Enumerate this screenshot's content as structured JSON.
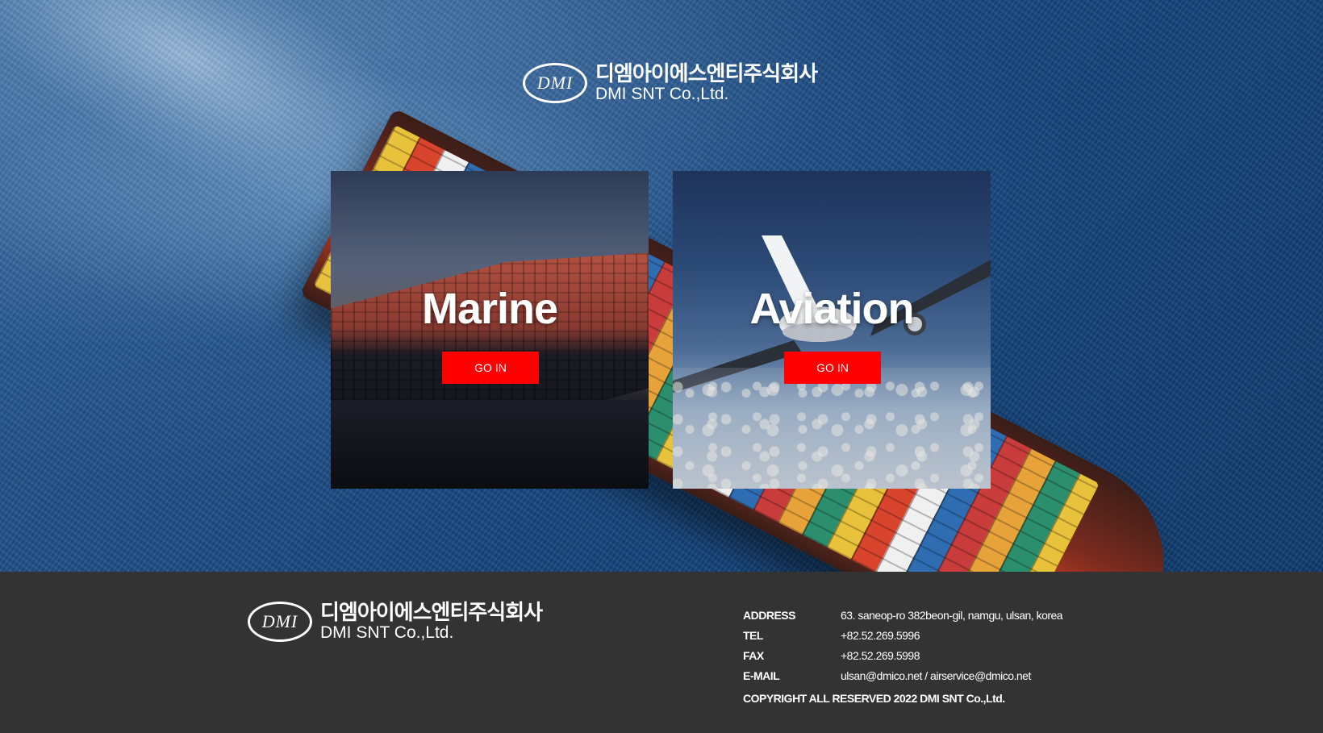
{
  "header": {
    "logo_mark": "DMI",
    "company_korean": "디엠아이에스엔티주식회사",
    "company_english": "DMI SNT Co.,Ltd."
  },
  "cards": [
    {
      "title": "Marine",
      "button_label": "GO IN"
    },
    {
      "title": "Aviation",
      "button_label": "GO IN"
    }
  ],
  "footer": {
    "logo_mark": "DMI",
    "company_korean": "디엠아이에스엔티주식회사",
    "company_english": "DMI SNT Co.,Ltd.",
    "info": [
      {
        "label": "ADDRESS",
        "value": "63. saneop-ro 382beon-gil, namgu, ulsan, korea"
      },
      {
        "label": "TEL",
        "value": "+82.52.269.5996"
      },
      {
        "label": "FAX",
        "value": "+82.52.269.5998"
      },
      {
        "label": "E-MAIL",
        "value": "ulsan@dmico.net / airservice@dmico.net"
      }
    ],
    "copyright": "COPYRIGHT ALL RESERVED 2022 DMI SNT Co.,Ltd."
  },
  "colors": {
    "accent_button": "#ff0000",
    "footer_bg": "#333333",
    "text": "#ffffff"
  }
}
